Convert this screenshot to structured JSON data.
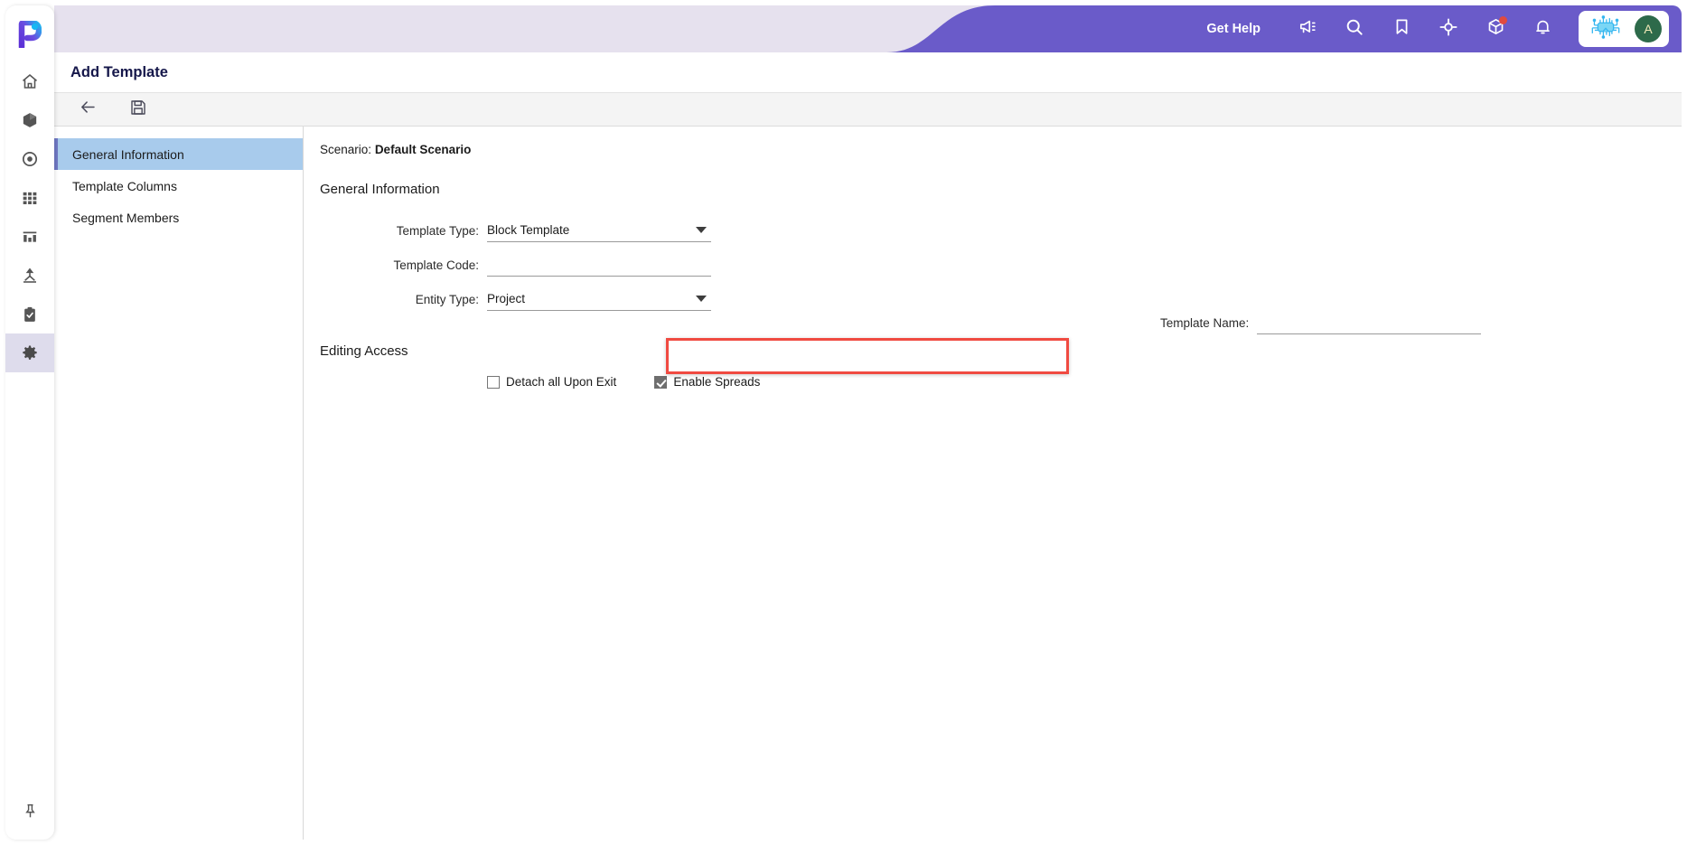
{
  "rail": {
    "logo_icon": "proda-logo-icon",
    "items": [
      {
        "icon": "home-icon",
        "name": "home",
        "active": false
      },
      {
        "icon": "box-icon",
        "name": "assets",
        "active": false
      },
      {
        "icon": "target-icon",
        "name": "target",
        "active": false
      },
      {
        "icon": "grid-icon",
        "name": "grid",
        "active": false
      },
      {
        "icon": "bar-chart-icon",
        "name": "reports",
        "active": false
      },
      {
        "icon": "hierarchy-icon",
        "name": "hierarchy",
        "active": false
      },
      {
        "icon": "clipboard-icon",
        "name": "tasks",
        "active": false
      },
      {
        "icon": "gear-icon",
        "name": "settings",
        "active": true
      }
    ],
    "pin_icon": "pin-icon"
  },
  "header": {
    "get_help_label": "Get Help",
    "icons": [
      {
        "name": "megaphone-icon",
        "badge": false
      },
      {
        "name": "search-icon",
        "badge": false
      },
      {
        "name": "bookmark-icon",
        "badge": false
      },
      {
        "name": "crosshair-icon",
        "badge": false
      },
      {
        "name": "cube-icon",
        "badge": true
      },
      {
        "name": "bell-icon",
        "badge": false
      }
    ],
    "ai_icon": "ai-chip-icon",
    "avatar_initial": "A",
    "accent_purple": "#6a5bc9",
    "header_bg": "#e6e1ee",
    "avatar_bg": "#2d6a4a",
    "badge_color": "#e04a3f"
  },
  "page": {
    "title": "Add Template"
  },
  "toolbar": {
    "buttons": [
      {
        "name": "back-button",
        "icon": "arrow-left-icon"
      },
      {
        "name": "save-button",
        "icon": "floppy-disk-icon"
      }
    ]
  },
  "nav": {
    "items": [
      {
        "label": "General Information",
        "active": true
      },
      {
        "label": "Template Columns",
        "active": false
      },
      {
        "label": "Segment Members",
        "active": false
      }
    ]
  },
  "content": {
    "scenario_prefix": "Scenario:",
    "scenario_value": "Default Scenario",
    "general_section_title": "General Information",
    "editing_section_title": "Editing Access",
    "fields": {
      "template_type": {
        "label": "Template Type:",
        "value": "Block Template",
        "type": "dropdown",
        "highlighted": true
      },
      "template_code": {
        "label": "Template Code:",
        "value": "",
        "type": "text"
      },
      "entity_type": {
        "label": "Entity Type:",
        "value": "Project",
        "type": "dropdown"
      },
      "template_name": {
        "label": "Template Name:",
        "value": "",
        "type": "text"
      }
    },
    "checkboxes": [
      {
        "label": "Detach all Upon Exit",
        "checked": false
      },
      {
        "label": "Enable Spreads",
        "checked": true
      }
    ],
    "highlight_color": "#f04a41"
  }
}
